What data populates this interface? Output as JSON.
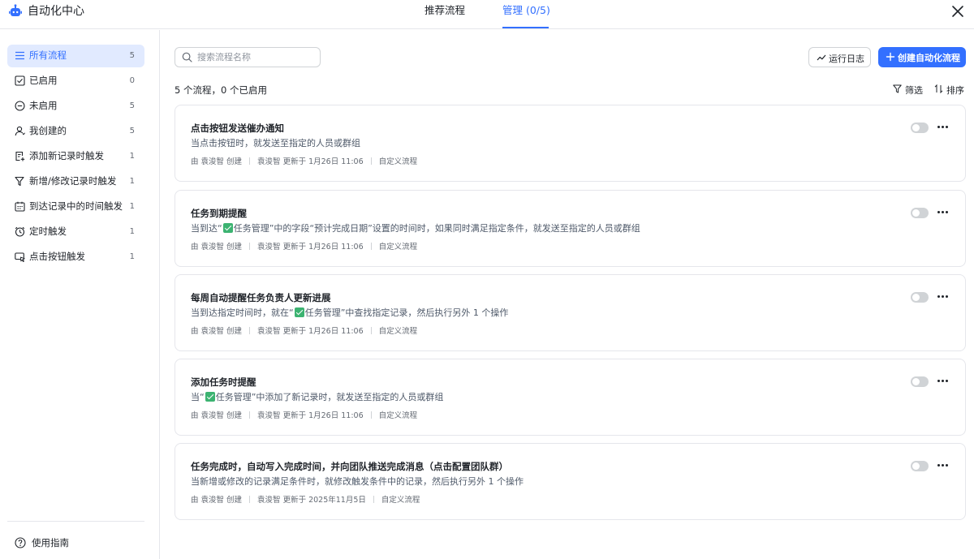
{
  "header": {
    "app_title": "自动化中心",
    "tabs": [
      {
        "label": "推荐流程"
      },
      {
        "label": "管理 (0/5)"
      }
    ]
  },
  "sidebar": {
    "items": [
      {
        "label": "所有流程",
        "count": "5",
        "icon": "list-icon"
      },
      {
        "label": "已启用",
        "count": "0",
        "icon": "checkbox-icon"
      },
      {
        "label": "未启用",
        "count": "5",
        "icon": "minus-circle-icon"
      },
      {
        "label": "我创建的",
        "count": "5",
        "icon": "user-icon"
      },
      {
        "label": "添加新记录时触发",
        "count": "1",
        "icon": "add-record-icon"
      },
      {
        "label": "新增/修改记录时触发",
        "count": "1",
        "icon": "filter-icon"
      },
      {
        "label": "到达记录中的时间触发",
        "count": "1",
        "icon": "calendar-icon"
      },
      {
        "label": "定时触发",
        "count": "1",
        "icon": "clock-icon"
      },
      {
        "label": "点击按钮触发",
        "count": "1",
        "icon": "button-icon"
      }
    ],
    "guide_label": "使用指南"
  },
  "toolbar": {
    "search_placeholder": "搜索流程名称",
    "log_label": "运行日志",
    "create_label": "创建自动化流程",
    "summary": "5 个流程，0 个已启用",
    "filter_label": "筛选",
    "sort_label": "排序"
  },
  "flows": [
    {
      "title": "点击按钮发送催办通知",
      "desc_parts": [
        "当点击按钮时，就发送至指定的人员或群组"
      ],
      "creator": "由 袁浚智 创建",
      "updated": "袁浚智 更新于 1月26日 11:06",
      "type": "自定义流程",
      "enabled": false
    },
    {
      "title": "任务到期提醒",
      "desc_parts": [
        "当到达“",
        "任务管理”中的字段“预计完成日期”设置的时间时，如果同时满足指定条件，就发送至指定的人员或群组"
      ],
      "creator": "由 袁浚智 创建",
      "updated": "袁浚智 更新于 1月26日 11:06",
      "type": "自定义流程",
      "enabled": false
    },
    {
      "title": "每周自动提醒任务负责人更新进展",
      "desc_parts": [
        "当到达指定时间时，就在“",
        "任务管理”中查找指定记录，然后执行另外 1 个操作"
      ],
      "creator": "由 袁浚智 创建",
      "updated": "袁浚智 更新于 1月26日 11:06",
      "type": "自定义流程",
      "enabled": false
    },
    {
      "title": "添加任务时提醒",
      "desc_parts": [
        "当“",
        "任务管理”中添加了新记录时，就发送至指定的人员或群组"
      ],
      "creator": "由 袁浚智 创建",
      "updated": "袁浚智 更新于 1月26日 11:06",
      "type": "自定义流程",
      "enabled": false
    },
    {
      "title": "任务完成时，自动写入完成时间，并向团队推送完成消息（点击配置团队群）",
      "desc_parts": [
        "当新增或修改的记录满足条件时，就修改触发条件中的记录，然后执行另外 1 个操作"
      ],
      "creator": "由 袁浚智 创建",
      "updated": "袁浚智 更新于 2025年11月5日",
      "type": "自定义流程",
      "enabled": false
    }
  ],
  "colors": {
    "accent": "#3370ff",
    "active_bg": "#e1eaff",
    "check_green": "#3cb371"
  }
}
